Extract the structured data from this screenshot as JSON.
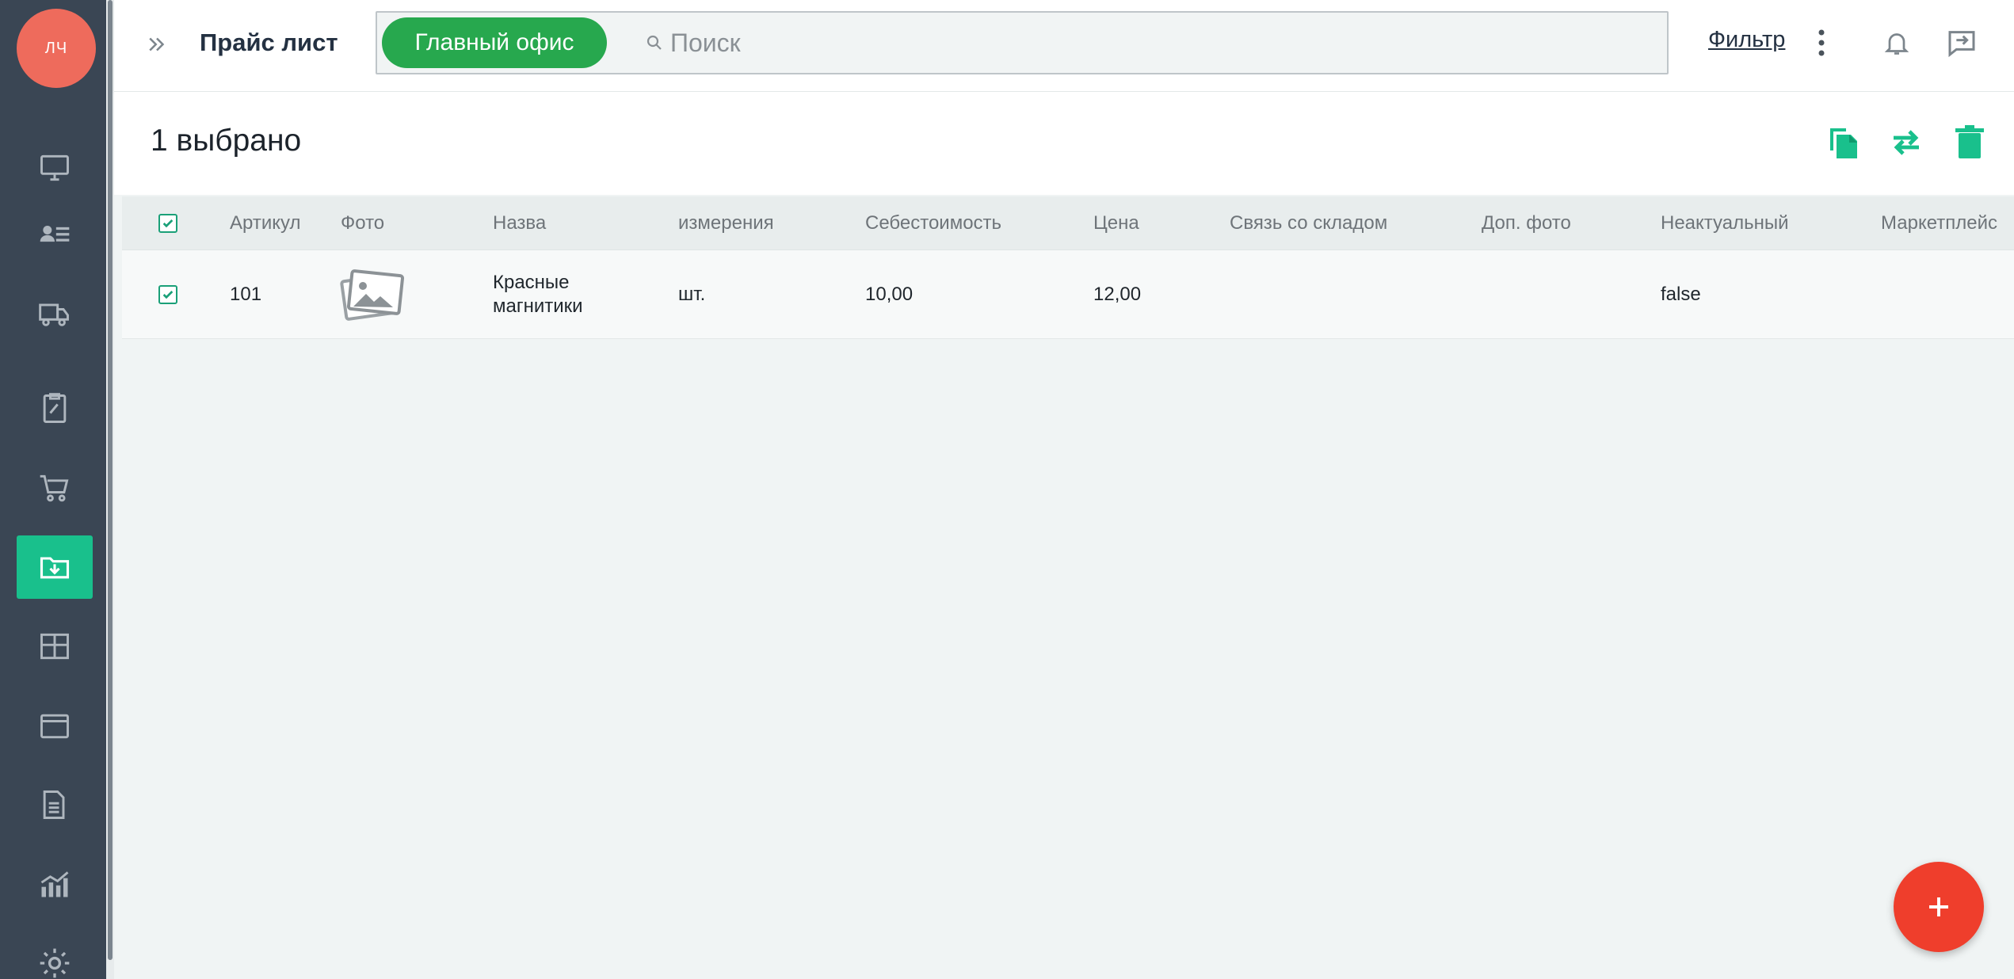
{
  "user": {
    "initials": "ЛЧ"
  },
  "sidebar": {
    "items": [
      {
        "icon": "monitor-icon"
      },
      {
        "icon": "contacts-icon"
      },
      {
        "icon": "truck-icon"
      },
      {
        "icon": "clipboard-icon"
      },
      {
        "icon": "cart-icon"
      },
      {
        "icon": "folder-download-icon",
        "active": true
      },
      {
        "icon": "box-icon"
      },
      {
        "icon": "wallet-icon"
      },
      {
        "icon": "report-icon"
      },
      {
        "icon": "chart-icon"
      },
      {
        "icon": "gear-icon"
      }
    ]
  },
  "header": {
    "title": "Прайс лист",
    "office_chip": "Главный офис",
    "search_placeholder": "Поиск",
    "filter_label": "Фильтр"
  },
  "selection": {
    "count_label": "1 выбрано"
  },
  "table": {
    "columns": [
      "Артикул",
      "Фото",
      "Назва",
      "измерения",
      "Себестоимость",
      "Цена",
      "Связь со складом",
      "Доп. фото",
      "Неактуальный",
      "Маркетплейс"
    ],
    "rows": [
      {
        "checked": true,
        "article": "101",
        "name_line1": "Красные",
        "name_line2": "магнитики",
        "unit": "шт.",
        "cost": "10,00",
        "price": "12,00",
        "warehouse_link": "",
        "extra_photo": "",
        "inactive": "false",
        "marketplace": ""
      }
    ]
  },
  "colors": {
    "accent": "#19c08c",
    "sidebar_bg": "#3a4654",
    "chip_bg": "#27a84e",
    "fab_bg": "#ef3e2c",
    "avatar_bg": "#ee6b5c"
  }
}
